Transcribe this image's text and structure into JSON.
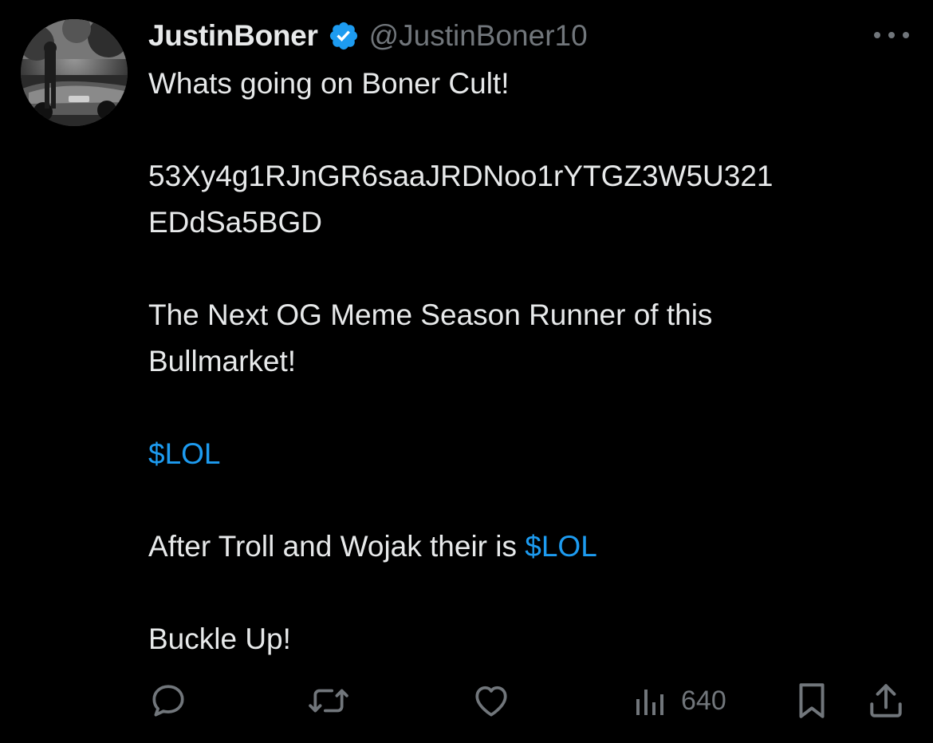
{
  "author": {
    "display_name": "JustinBoner",
    "handle": "@JustinBoner10",
    "verified": true,
    "avatar_icon": "profile-photo"
  },
  "tweet": {
    "lines": {
      "greeting": "Whats going on Boner Cult!",
      "address_part1": "53Xy4g1RJnGR6saaJRDNoo1rYTGZ3W5U321",
      "address_part2": "EDdSa5BGD",
      "pitch_part1": "The Next OG Meme Season Runner of this",
      "pitch_part2": "Bullmarket!",
      "cashtag_line": "$LOL",
      "after_prefix": "After Troll and Wojak their is ",
      "after_cashtag": "$LOL",
      "closing": "Buckle Up!"
    }
  },
  "actions": {
    "reply_icon": "reply-icon",
    "retweet_icon": "retweet-icon",
    "like_icon": "heart-icon",
    "views_icon": "views-bar-chart-icon",
    "views_count": "640",
    "bookmark_icon": "bookmark-icon",
    "share_icon": "share-icon"
  },
  "colors": {
    "background": "#000000",
    "text_primary": "#e7e9ea",
    "text_secondary": "#71767b",
    "accent": "#1d9bf0"
  }
}
